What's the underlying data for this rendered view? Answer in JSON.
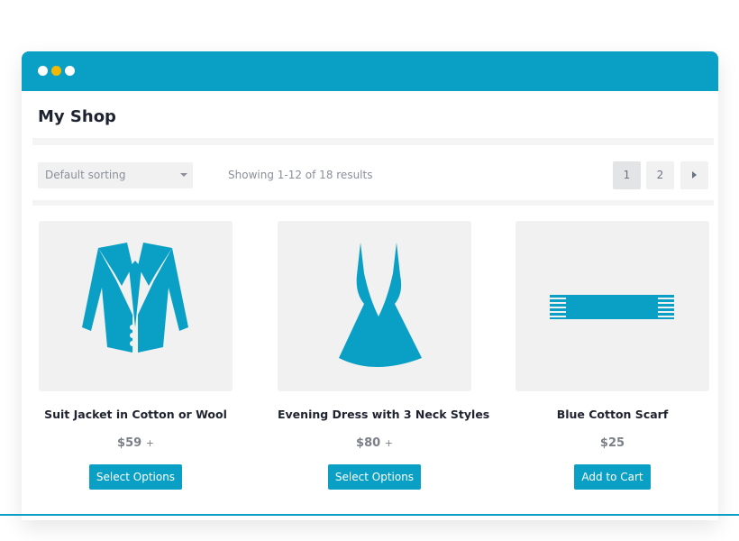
{
  "window": {
    "dots": [
      "white",
      "yellow",
      "white"
    ],
    "accent": "#0aa0c6"
  },
  "shop": {
    "title": "My Shop"
  },
  "toolbar": {
    "sorting": "Default sorting",
    "result_count": "Showing 1-12 of 18 results",
    "pages": [
      "1",
      "2"
    ],
    "current_page": "1"
  },
  "products": [
    {
      "name": "Suit Jacket in Cotton or Wool",
      "price": "$59",
      "price_suffix": "+",
      "button": "Select Options",
      "icon": "jacket-icon"
    },
    {
      "name": "Evening Dress with 3 Neck Styles",
      "price": "$80",
      "price_suffix": "+",
      "button": "Select Options",
      "icon": "dress-icon"
    },
    {
      "name": "Blue Cotton Scarf",
      "price": "$25",
      "price_suffix": "",
      "button": "Add to Cart",
      "icon": "scarf-icon"
    }
  ]
}
